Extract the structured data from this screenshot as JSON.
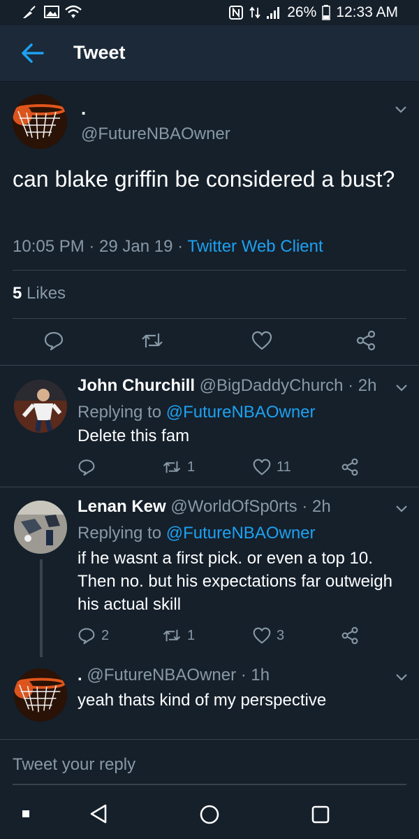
{
  "status_bar": {
    "battery": "26%",
    "time": "12:33 AM"
  },
  "header": {
    "title": "Tweet"
  },
  "tweet": {
    "display_name": ".",
    "handle": "@FutureNBAOwner",
    "text": "can blake griffin be considered a bust?",
    "time": "10:05 PM · 29 Jan 19 · ",
    "client": "Twitter Web Client",
    "likes_count": "5",
    "likes_label": " Likes"
  },
  "replies": [
    {
      "name": "John Churchill",
      "handle_time": " @BigDaddyChurch · 2h",
      "replying_label": "Replying to ",
      "replying_to": "@FutureNBAOwner",
      "text": "Delete this fam",
      "replies": "",
      "retweets": "1",
      "likes": "11"
    },
    {
      "name": "Lenan Kew",
      "handle_time": " @WorldOfSp0rts · 2h",
      "replying_label": "Replying to ",
      "replying_to": "@FutureNBAOwner",
      "text": "if he wasnt a first pick. or even a top 10. Then no. but his expectations far outweigh his actual skill",
      "replies": "2",
      "retweets": "1",
      "likes": "3"
    },
    {
      "name": ".",
      "handle_time": " @FutureNBAOwner · 1h",
      "text": "yeah thats kind of my perspective"
    }
  ],
  "reply_input": {
    "placeholder": "Tweet your reply"
  },
  "colors": {
    "background": "#15202b",
    "accent": "#1da1f2",
    "muted": "#8899a6",
    "divider": "#38444d"
  }
}
